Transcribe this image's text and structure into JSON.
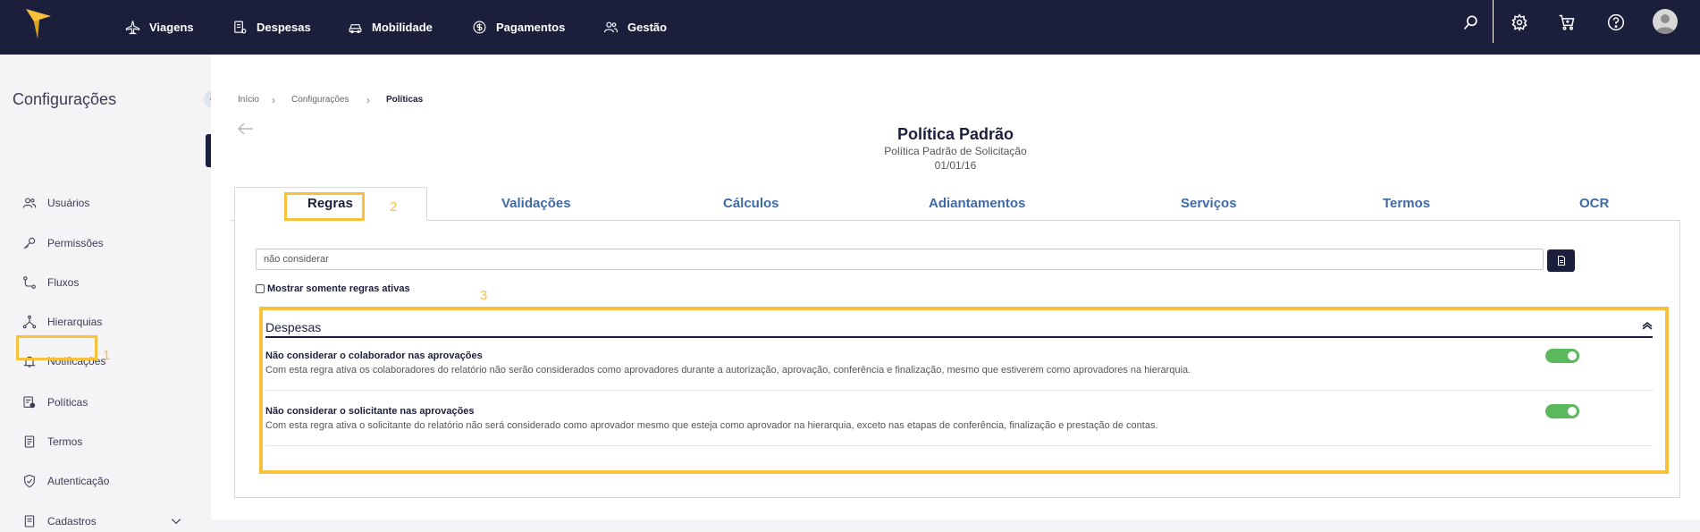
{
  "nav": {
    "items": [
      {
        "label": "Viagens",
        "icon": "plane-icon"
      },
      {
        "label": "Despesas",
        "icon": "receipt-icon"
      },
      {
        "label": "Mobilidade",
        "icon": "car-icon"
      },
      {
        "label": "Pagamentos",
        "icon": "dollar-icon"
      },
      {
        "label": "Gestão",
        "icon": "users-icon"
      }
    ]
  },
  "sidebar": {
    "title": "Configurações",
    "items": [
      {
        "label": "Usuários"
      },
      {
        "label": "Permissões"
      },
      {
        "label": "Fluxos"
      },
      {
        "label": "Hierarquias"
      },
      {
        "label": "Notificações"
      },
      {
        "label": "Políticas"
      },
      {
        "label": "Termos"
      },
      {
        "label": "Autenticação"
      },
      {
        "label": "Cadastros"
      }
    ]
  },
  "breadcrumb": [
    "Início",
    "Configurações",
    "Políticas"
  ],
  "policy": {
    "title": "Política Padrão",
    "subtitle": "Política Padrão de Solicitação",
    "date": "01/01/16"
  },
  "tabs": [
    "Regras",
    "Validações",
    "Cálculos",
    "Adiantamentos",
    "Serviços",
    "Termos",
    "OCR"
  ],
  "search": {
    "value": "não considerar"
  },
  "filter": {
    "label": "Mostrar somente regras ativas"
  },
  "group": {
    "title": "Despesas",
    "rules": [
      {
        "title": "Não considerar o colaborador nas aprovações",
        "description": "Com esta regra ativa os colaboradores do relatório não serão considerados como aprovadores durante a autorização, aprovação, conferência e finalização, mesmo que estiverem como aprovadores na hierarquia."
      },
      {
        "title": "Não considerar o solicitante nas aprovações",
        "description": "Com esta regra ativa o solicitante do relatório não será considerado como aprovador mesmo que esteja como aprovador na hierarquia, exceto nas etapas de conferência, finalização e prestação de contas."
      }
    ]
  },
  "annotations": [
    "1",
    "2",
    "3"
  ],
  "colors": {
    "navbar": "#1b1f3b",
    "highlight": "#f8c03b",
    "toggle_on": "#5cb85c",
    "tab_link": "#3d6aa8"
  }
}
